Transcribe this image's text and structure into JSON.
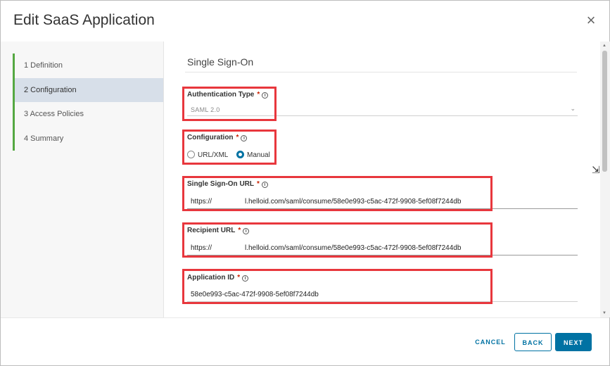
{
  "dialog": {
    "title": "Edit SaaS Application",
    "close_glyph": "×"
  },
  "sidebar": {
    "steps": [
      {
        "label": "1  Definition",
        "active": false
      },
      {
        "label": "2  Configuration",
        "active": true
      },
      {
        "label": "3  Access Policies",
        "active": false
      },
      {
        "label": "4  Summary",
        "active": false
      }
    ]
  },
  "section": {
    "title": "Single Sign-On"
  },
  "fields": {
    "auth_type": {
      "label": "Authentication Type",
      "required": "*",
      "value": "SAML 2.0"
    },
    "configuration": {
      "label": "Configuration",
      "required": "*",
      "options": [
        {
          "label": "URL/XML",
          "checked": false
        },
        {
          "label": "Manual",
          "checked": true
        }
      ]
    },
    "sso_url": {
      "label": "Single Sign-On URL",
      "required": "*",
      "value_prefix": "https://",
      "value_suffix": "l.helloid.com/saml/consume/58e0e993-c5ac-472f-9908-5ef08f7244db"
    },
    "recipient_url": {
      "label": "Recipient URL",
      "required": "*",
      "value_prefix": "https://",
      "value_suffix": "l.helloid.com/saml/consume/58e0e993-c5ac-472f-9908-5ef08f7244db"
    },
    "application_id": {
      "label": "Application ID",
      "required": "*",
      "value": "58e0e993-c5ac-472f-9908-5ef08f7244db"
    }
  },
  "footer": {
    "cancel_label": "CANCEL",
    "back_label": "BACK",
    "next_label": "NEXT"
  },
  "icons": {
    "info": "info-icon",
    "chevron": "chevron-down-icon",
    "close": "close-icon"
  },
  "colors": {
    "accent": "#0072a3",
    "step_bar": "#55a842",
    "highlight": "#e8373d",
    "active_step": "#d7dfe9"
  }
}
